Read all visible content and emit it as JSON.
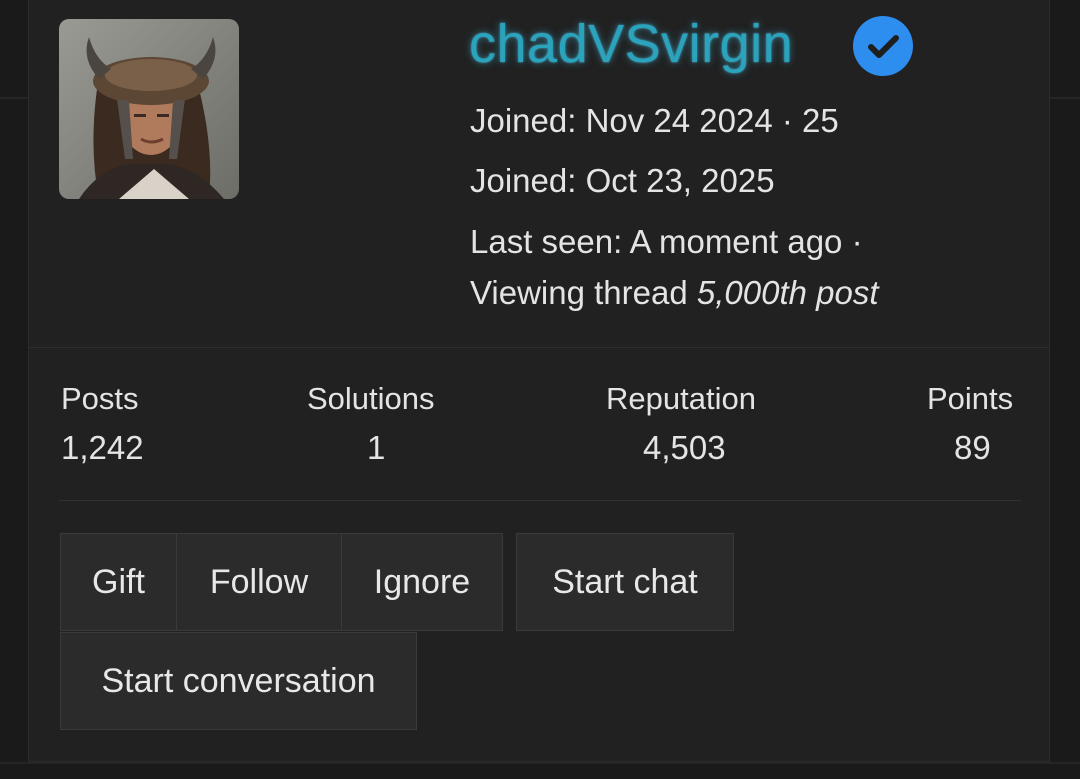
{
  "profile": {
    "username": "chadVSvirgin",
    "joined_line_1": "Joined: Nov 24 2024 · 25",
    "joined_line_2": "Joined: Oct 23, 2025",
    "last_seen_line": "Last seen: A moment ago ·",
    "viewing_prefix": "Viewing thread ",
    "viewing_thread": "5,000th post",
    "username_color": "#2aa3bd",
    "verified_color": "#2d8ef0",
    "avatar_icon": "avatar-photo-warrior-helmet",
    "verified_icon": "verified-check-badge-icon"
  },
  "stats": {
    "posts": {
      "label": "Posts",
      "value": "1,242"
    },
    "solutions": {
      "label": "Solutions",
      "value": "1"
    },
    "reputation": {
      "label": "Reputation",
      "value": "4,503"
    },
    "points": {
      "label": "Points",
      "value": "89"
    }
  },
  "actions": {
    "gift": "Gift",
    "follow": "Follow",
    "ignore": "Ignore",
    "start_chat": "Start chat",
    "start_conversation": "Start conversation"
  }
}
